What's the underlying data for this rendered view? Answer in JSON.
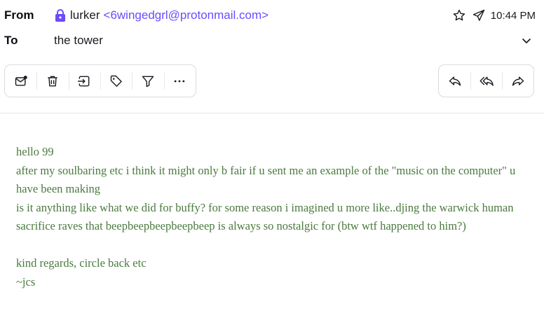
{
  "header": {
    "from_label": "From",
    "sender_name": "lurker",
    "sender_email": "<6wingedgrl@protonmail.com>",
    "to_label": "To",
    "recipient": "the tower",
    "time": "10:44 PM"
  },
  "icons": {
    "lock": "lock-icon",
    "star": "star-icon",
    "sent": "paper-plane-icon",
    "expand": "chevron-down-icon"
  },
  "toolbar": {
    "left": [
      "mark-unread",
      "trash",
      "move-to-folder",
      "label",
      "filter",
      "more"
    ],
    "right": [
      "reply",
      "reply-all",
      "forward"
    ]
  },
  "colors": {
    "accent": "#6d4aff",
    "lock": "#6d4aff",
    "body_text": "#4a7a3e",
    "border": "#dadbe2"
  },
  "message": {
    "greeting": "hello 99",
    "para1": "after my soulbaring etc i think it might only b fair if u sent me an example of the \"music on the computer\" u have been making",
    "para2": "is it anything like what we did for buffy? for some reason i imagined u more like..djing the warwick human sacrifice raves that beepbeepbeepbeepbeep is always so nostalgic for (btw wtf happened to him?)",
    "signoff": "kind regards, circle back etc",
    "signature": "~jcs"
  }
}
